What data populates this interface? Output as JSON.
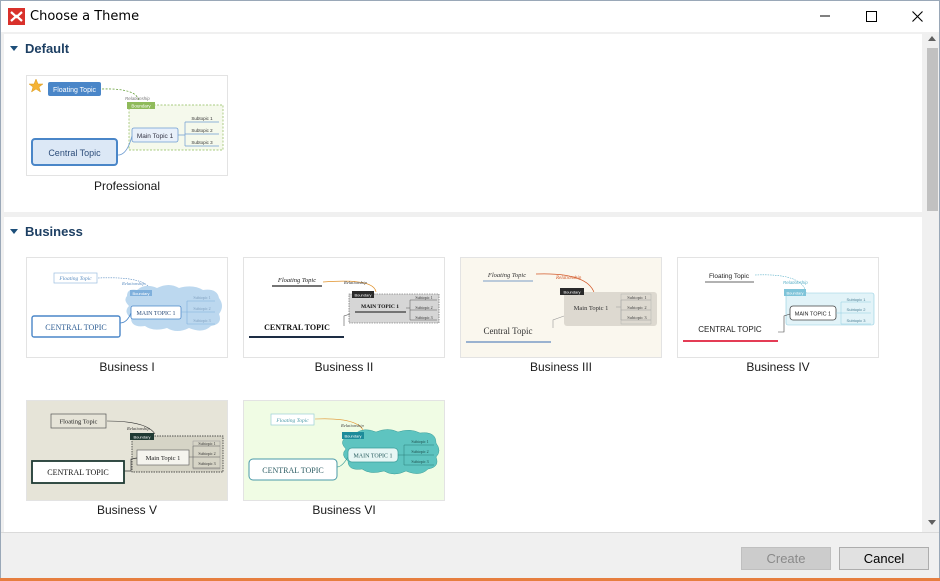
{
  "window": {
    "title": "Choose a Theme"
  },
  "sections": {
    "default": {
      "title": "Default",
      "themes": [
        {
          "label": "Professional"
        }
      ]
    },
    "business": {
      "title": "Business",
      "themes": [
        {
          "label": "Business I"
        },
        {
          "label": "Business II"
        },
        {
          "label": "Business III"
        },
        {
          "label": "Business IV"
        },
        {
          "label": "Business V"
        },
        {
          "label": "Business VI"
        }
      ]
    }
  },
  "previews": {
    "floating_topic": "Floating Topic",
    "floating_topic_upper": "FLOATING TOPIC",
    "relationship": "Relationship",
    "boundary": "Boundary",
    "main_topic": "Main Topic 1",
    "main_topic_upper": "MAIN TOPIC 1",
    "subtopics": [
      "Subtopic 1",
      "Subtopic 2",
      "Subtopic 3"
    ],
    "central_topic": "Central Topic",
    "central_topic_upper": "CENTRAL TOPIC"
  },
  "footer": {
    "create_label": "Create",
    "cancel_label": "Cancel"
  },
  "colors": {
    "accent": "#1d3f63",
    "app_icon": "#d9312b",
    "professional_blue": "#4a86c8",
    "professional_green": "#8fba5a"
  }
}
